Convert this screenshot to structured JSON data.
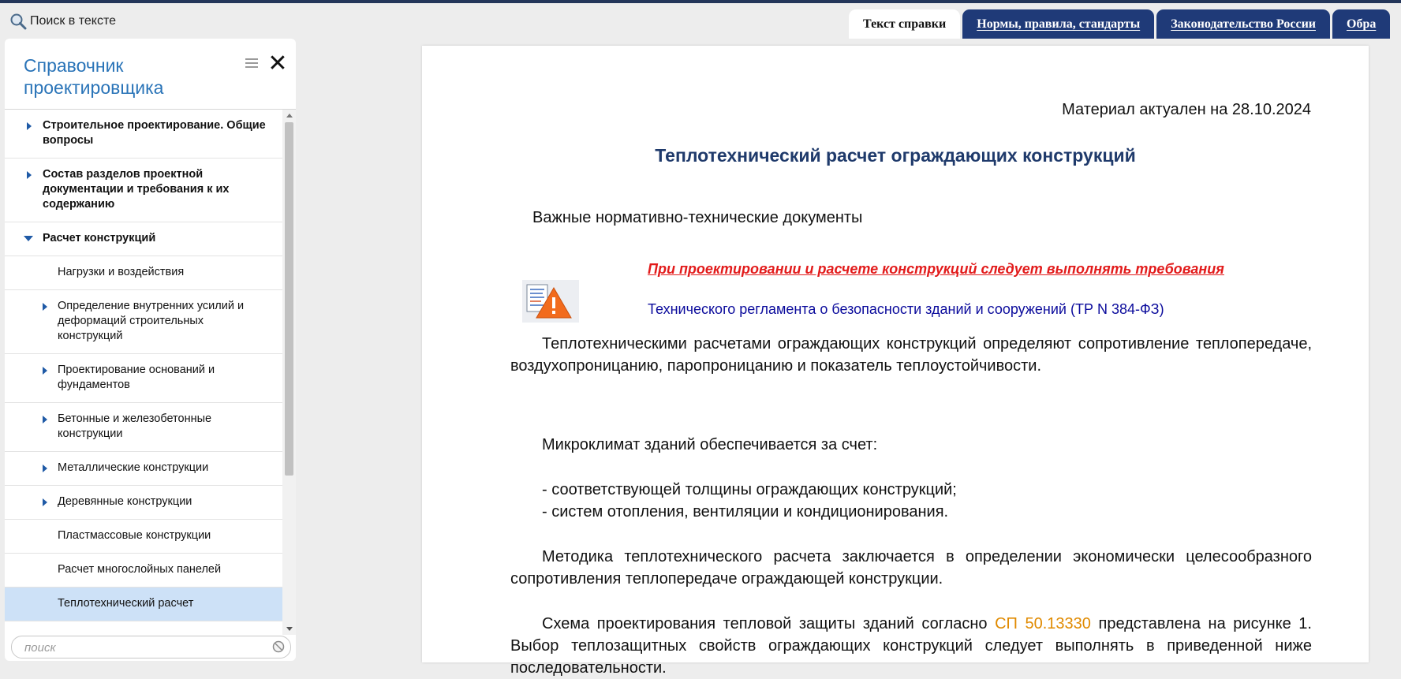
{
  "toolbar": {
    "search_in_text": "Поиск в тексте",
    "tabs": [
      {
        "label": "Текст справки",
        "active": true
      },
      {
        "label": "Нормы, правила, стандарты",
        "active": false
      },
      {
        "label": "Законодательство России",
        "active": false
      },
      {
        "label": "Обра",
        "active": false
      }
    ]
  },
  "sidebar": {
    "title": "Справочник проектировщика",
    "search_placeholder": "поиск",
    "items": [
      {
        "label": "Строительное проектирование. Общие вопросы",
        "level": 1,
        "expand": "collapsed"
      },
      {
        "label": "Состав разделов проектной документации и требования к их содержанию",
        "level": 1,
        "expand": "collapsed"
      },
      {
        "label": "Расчет конструкций",
        "level": 1,
        "expand": "expanded"
      },
      {
        "label": "Нагрузки и воздействия",
        "level": 2,
        "expand": "none"
      },
      {
        "label": "Определение внутренних усилий и деформаций строительных конструкций",
        "level": 2,
        "expand": "collapsed"
      },
      {
        "label": "Проектирование оснований и фундаментов",
        "level": 2,
        "expand": "collapsed"
      },
      {
        "label": "Бетонные и железобетонные конструкции",
        "level": 2,
        "expand": "collapsed"
      },
      {
        "label": "Металлические конструкции",
        "level": 2,
        "expand": "collapsed"
      },
      {
        "label": "Деревянные конструкции",
        "level": 2,
        "expand": "collapsed"
      },
      {
        "label": "Пластмассовые конструкции",
        "level": 2,
        "expand": "none"
      },
      {
        "label": "Расчет многослойных панелей",
        "level": 2,
        "expand": "none"
      },
      {
        "label": "Теплотехнический расчет",
        "level": 2,
        "expand": "none",
        "selected": true
      }
    ]
  },
  "document": {
    "date_line": "Материал актуален на 28.10.2024",
    "title": "Теплотехнический расчет ограждающих конструкций",
    "subheading": "Важные нормативно-технические документы",
    "warning_red": "При проектировании и расчете  конструкций следует выполнять требования",
    "warning_blue_text": "Технического регламента о безопасности зданий и сооружений",
    "warning_blue_open": " (",
    "warning_blue_link": "ТР N 384-ФЗ",
    "warning_blue_close": ")",
    "para1": "Теплотехническими расчетами ограждающих конструкций определяют сопротивление теплопередаче, воздухопроницанию, паропроницанию и показатель теплоустойчивости.",
    "para2": "Микроклимат зданий обеспечивается за счет:",
    "list": [
      "- соответствующей толщины ограждающих конструкций;",
      "- систем отопления, вентиляции и кондиционирования."
    ],
    "para3": "Методика теплотехнического расчета заключается в определении экономически целесообразного сопротивления теплопередаче ограждающей конструкции.",
    "para4_a": "Схема проектирования тепловой защиты зданий согласно ",
    "para4_link": "СП 50.13330",
    "para4_b": " представлена на рисунке 1. Выбор теплозащитных свойств ограждающих конструкций следует выполнять в приведенной ниже последовательности."
  },
  "colors": {
    "tab_dark": "#1f3a78",
    "sidebar_title": "#2a74b8",
    "doc_title": "#1f3a6b",
    "warning_red": "#e21b1b",
    "warning_blue": "#0b0b9c",
    "link_orange": "#e08a00",
    "selected_item": "#cde1f7"
  }
}
